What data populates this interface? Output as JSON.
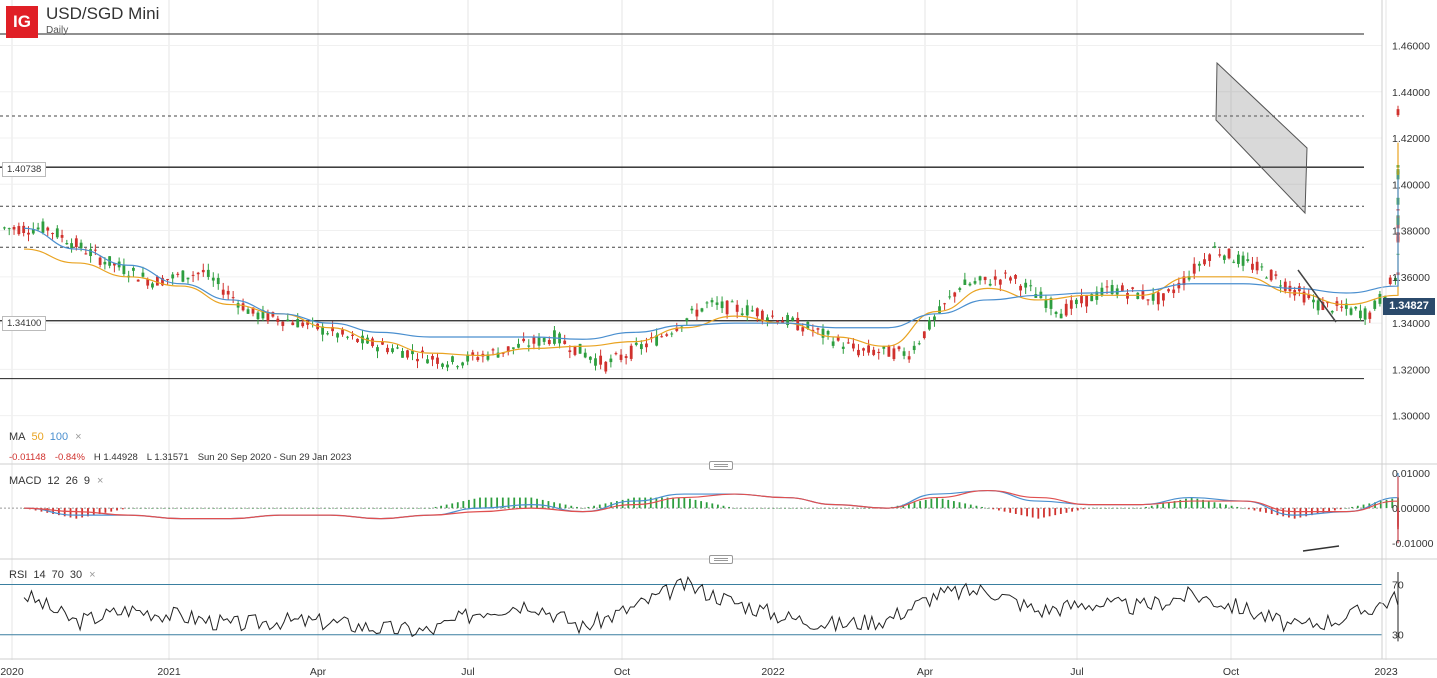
{
  "header": {
    "logo_text": "IG",
    "instrument": "USD/SGD Mini",
    "interval": "Daily"
  },
  "ma_panel": {
    "label": "MA",
    "params": [
      "50",
      "100"
    ],
    "close": "×"
  },
  "stats": {
    "change": "-0.01148",
    "change_pct": "-0.84%",
    "high": "H 1.44928",
    "low": "L 1.31571",
    "range": "Sun 20 Sep 2020 - Sun 29 Jan 2023"
  },
  "macd_panel": {
    "label": "MACD",
    "params": [
      "12",
      "26",
      "9"
    ],
    "close": "×"
  },
  "rsi_panel": {
    "label": "RSI",
    "params": [
      "14",
      "70",
      "30"
    ],
    "close": "×"
  },
  "level_tags": {
    "upper": "1.40738",
    "lower": "1.34100"
  },
  "last_price": "1.34827",
  "colors": {
    "brand": "#e01f26",
    "up_candle": "#2e9e3f",
    "down_candle": "#d0312d",
    "ma50": "#e9a321",
    "ma100": "#4a8fcf",
    "macd_line": "#4a8fcf",
    "signal_line": "#e05050",
    "rsi_line": "#222222",
    "rsi_bands": "#3a7fa0",
    "price_tag": "#2b4a6b"
  },
  "chart_data": [
    {
      "type": "line",
      "name_note": "price panel (daily candlesticks with moving averages)",
      "x_axis_ticks": [
        "2020",
        "2021",
        "Apr",
        "Jul",
        "Oct",
        "2022",
        "Apr",
        "Jul",
        "Oct",
        "2023"
      ],
      "y_axis_ticks": [
        "1.30000",
        "1.32000",
        "1.34000",
        "1.36000",
        "1.38000",
        "1.40000",
        "1.42000",
        "1.44000",
        "1.46000"
      ],
      "ylim": [
        1.286,
        1.468
      ],
      "x": [
        "2020-01",
        "2020-02",
        "2020-03",
        "2020-04",
        "2020-05",
        "2020-06",
        "2020-07",
        "2020-08",
        "2020-09",
        "2020-10",
        "2020-11",
        "2020-12",
        "2021-01",
        "2021-02",
        "2021-03",
        "2021-04",
        "2021-05",
        "2021-06",
        "2021-07",
        "2021-08",
        "2021-09",
        "2021-10",
        "2021-11",
        "2021-12",
        "2022-01",
        "2022-02",
        "2022-03",
        "2022-04",
        "2022-05",
        "2022-06",
        "2022-07",
        "2022-08",
        "2022-09",
        "2022-10",
        "2022-11",
        "2022-12"
      ],
      "series": [
        {
          "name": "Close",
          "values": [
            1.381,
            1.368,
            1.358,
            1.362,
            1.344,
            1.34,
            1.333,
            1.328,
            1.323,
            1.328,
            1.334,
            1.322,
            1.333,
            1.348,
            1.345,
            1.338,
            1.328,
            1.327,
            1.356,
            1.36,
            1.345,
            1.355,
            1.35,
            1.372,
            1.362,
            1.348,
            1.344,
            1.36,
            1.378,
            1.388,
            1.403,
            1.385,
            1.388,
            1.432,
            1.376,
            1.348
          ]
        },
        {
          "name": "50",
          "values": [
            1.372,
            1.366,
            1.36,
            1.356,
            1.348,
            1.344,
            1.338,
            1.332,
            1.327,
            1.326,
            1.329,
            1.33,
            1.332,
            1.338,
            1.343,
            1.34,
            1.334,
            1.33,
            1.345,
            1.355,
            1.35,
            1.352,
            1.352,
            1.36,
            1.36,
            1.353,
            1.348,
            1.352,
            1.365,
            1.38,
            1.393,
            1.39,
            1.392,
            1.418,
            1.405,
            1.385
          ]
        },
        {
          "name": "100",
          "values": [
            1.381,
            1.372,
            1.365,
            1.357,
            1.35,
            1.344,
            1.34,
            1.336,
            1.334,
            1.334,
            1.334,
            1.333,
            1.336,
            1.339,
            1.34,
            1.34,
            1.338,
            1.338,
            1.344,
            1.35,
            1.352,
            1.353,
            1.354,
            1.357,
            1.357,
            1.355,
            1.353,
            1.356,
            1.363,
            1.374,
            1.383,
            1.387,
            1.393,
            1.404,
            1.403,
            1.4
          ]
        }
      ],
      "horizontal_levels": [
        1.4074,
        1.341,
        1.465,
        1.316,
        1.4295,
        1.3905,
        1.3728
      ]
    },
    {
      "type": "line",
      "name_note": "MACD panel",
      "y_axis_ticks": [
        "0.01000",
        "0.00000",
        "-0.01000"
      ],
      "ylim": [
        -0.0142,
        0.0117
      ],
      "x": [
        "2020-01",
        "2020-02",
        "2020-03",
        "2020-04",
        "2020-05",
        "2020-06",
        "2020-07",
        "2020-08",
        "2020-09",
        "2020-10",
        "2020-11",
        "2020-12",
        "2021-01",
        "2021-02",
        "2021-03",
        "2021-04",
        "2021-05",
        "2021-06",
        "2021-07",
        "2021-08",
        "2021-09",
        "2021-10",
        "2021-11",
        "2021-12",
        "2022-01",
        "2022-02",
        "2022-03",
        "2022-04",
        "2022-05",
        "2022-06",
        "2022-07",
        "2022-08",
        "2022-09",
        "2022-10",
        "2022-11",
        "2022-12"
      ],
      "series": [
        {
          "name": "MACD",
          "values": [
            0.0,
            -0.002,
            -0.002,
            -0.003,
            -0.003,
            -0.002,
            -0.002,
            -0.003,
            -0.002,
            0.0,
            0.001,
            -0.001,
            0.002,
            0.004,
            0.004,
            0.003,
            0.001,
            0.0,
            0.004,
            0.005,
            0.002,
            0.001,
            0.001,
            0.003,
            0.002,
            -0.002,
            -0.001,
            0.003,
            0.004,
            0.006,
            0.005,
            0.002,
            0.004,
            0.01,
            -0.004,
            -0.01
          ]
        },
        {
          "name": "Signal",
          "values": [
            0.0,
            -0.001,
            -0.002,
            -0.003,
            -0.003,
            -0.002,
            -0.002,
            -0.003,
            -0.002,
            -0.001,
            0.0,
            -0.001,
            0.001,
            0.003,
            0.004,
            0.003,
            0.001,
            0.0,
            0.003,
            0.005,
            0.003,
            0.001,
            0.001,
            0.002,
            0.002,
            -0.001,
            -0.001,
            0.002,
            0.004,
            0.006,
            0.005,
            0.003,
            0.003,
            0.009,
            -0.002,
            -0.01
          ]
        }
      ]
    },
    {
      "type": "line",
      "name_note": "RSI panel",
      "y_axis_ticks": [
        "70",
        "30"
      ],
      "ylim": [
        13,
        88
      ],
      "x": [
        "2020-01",
        "2020-02",
        "2020-03",
        "2020-04",
        "2020-05",
        "2020-06",
        "2020-07",
        "2020-08",
        "2020-09",
        "2020-10",
        "2020-11",
        "2020-12",
        "2021-01",
        "2021-02",
        "2021-03",
        "2021-04",
        "2021-05",
        "2021-06",
        "2021-07",
        "2021-08",
        "2021-09",
        "2021-10",
        "2021-11",
        "2021-12",
        "2022-01",
        "2022-02",
        "2022-03",
        "2022-04",
        "2022-05",
        "2022-06",
        "2022-07",
        "2022-08",
        "2022-09",
        "2022-10",
        "2022-11",
        "2022-12"
      ],
      "series": [
        {
          "name": "RSI",
          "values": [
            62,
            40,
            50,
            45,
            38,
            41,
            40,
            35,
            33,
            49,
            55,
            36,
            52,
            70,
            56,
            44,
            38,
            42,
            62,
            66,
            49,
            55,
            52,
            62,
            51,
            36,
            44,
            60,
            64,
            60,
            68,
            47,
            58,
            76,
            34,
            28
          ]
        }
      ]
    }
  ]
}
